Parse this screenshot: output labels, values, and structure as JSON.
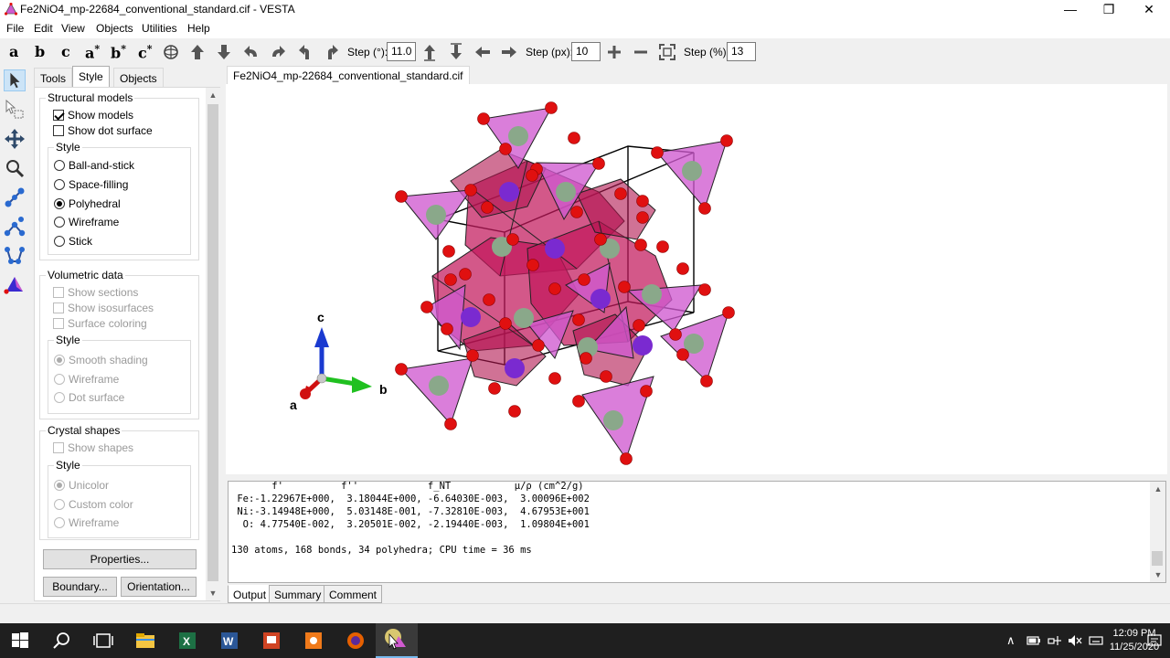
{
  "window": {
    "title": "Fe2NiO4_mp-22684_conventional_standard.cif - VESTA"
  },
  "menu": [
    "File",
    "Edit",
    "View",
    "Objects",
    "Utilities",
    "Help"
  ],
  "toolbar": {
    "axes": [
      {
        "base": "a",
        "sup": ""
      },
      {
        "base": "b",
        "sup": ""
      },
      {
        "base": "c",
        "sup": ""
      },
      {
        "base": "a",
        "sup": "*"
      },
      {
        "base": "b",
        "sup": "*"
      },
      {
        "base": "c",
        "sup": "*"
      }
    ],
    "step_deg_label": "Step (°):",
    "step_deg_value": "11.0",
    "step_px_label": "Step (px):",
    "step_px_value": "10",
    "step_pct_label": "Step (%):",
    "step_pct_value": "13"
  },
  "panel": {
    "tabs": [
      "Tools",
      "Style",
      "Objects"
    ],
    "active_tab": "Style",
    "structural": {
      "title": "Structural models",
      "show_models": "Show models",
      "show_dot_surface": "Show dot surface",
      "style_title": "Style",
      "styles": [
        "Ball-and-stick",
        "Space-filling",
        "Polyhedral",
        "Wireframe",
        "Stick"
      ],
      "selected_style": "Polyhedral"
    },
    "volumetric": {
      "title": "Volumetric data",
      "show_sections": "Show sections",
      "show_isosurfaces": "Show isosurfaces",
      "surface_coloring": "Surface coloring",
      "style_title": "Style",
      "styles": [
        "Smooth shading",
        "Wireframe",
        "Dot surface"
      ]
    },
    "crystal": {
      "title": "Crystal shapes",
      "show_shapes": "Show shapes",
      "style_title": "Style",
      "styles": [
        "Unicolor",
        "Custom color",
        "Wireframe"
      ]
    },
    "properties_button": "Properties...",
    "boundary_button": "Boundary...",
    "orientation_button": "Orientation..."
  },
  "viewer": {
    "tab": "Fe2NiO4_mp-22684_conventional_standard.cif",
    "axis_labels": {
      "a": "a",
      "b": "b",
      "c": "c"
    }
  },
  "output": {
    "lines": [
      "       f'          f''            f_NT           μ/ρ (cm^2/g)",
      " Fe:-1.22967E+000,  3.18044E+000, -6.64030E-003,  3.00096E+002",
      " Ni:-3.14948E+000,  5.03148E-001, -7.32810E-003,  4.67953E+001",
      "  O: 4.77540E-002,  3.20501E-002, -2.19440E-003,  1.09804E+001",
      "",
      "130 atoms, 168 bonds, 34 polyhedra; CPU time = 36 ms"
    ],
    "tabs": [
      "Output",
      "Summary",
      "Comment"
    ],
    "active_tab": "Output"
  },
  "taskbar": {
    "time": "12:09 PM",
    "date": "11/25/2020"
  },
  "colors": {
    "oxygen": "#e01010",
    "fe_poly": "#d05ad0",
    "ni_poly": "#c2185b",
    "fe_atom": "#8aa88a",
    "ni_atom": "#7a2ad0"
  }
}
